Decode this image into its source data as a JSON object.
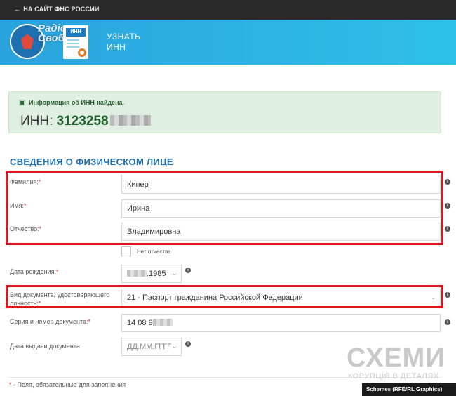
{
  "topbar": {
    "back_label": "НА САЙТ ФНС РОССИИ"
  },
  "banner": {
    "watermark": "Радіо\nСвобода",
    "doc_tag": "ИНН",
    "title": "УЗНАТЬ\nИНН"
  },
  "alert": {
    "message": "Информация об ИНН найдена.",
    "inn_label": "ИНН: ",
    "inn_value": "3123258"
  },
  "section_title": "СВЕДЕНИЯ О ФИЗИЧЕСКОМ ЛИЦЕ",
  "form": {
    "surname": {
      "label": "Фамилия:",
      "value": "Кипер"
    },
    "name": {
      "label": "Имя:",
      "value": "Ирина"
    },
    "patronymic": {
      "label": "Отчество:",
      "value": "Владимировна"
    },
    "no_patronymic_label": "Нет отчества",
    "birth_date": {
      "label": "Дата рождения:",
      "value_suffix": ".1985"
    },
    "doc_type": {
      "label": "Вид документа, удостоверяющего личность:",
      "value": "21 - Паспорт гражданина Российской Федерации"
    },
    "doc_number": {
      "label": "Серия и номер документа:",
      "value": "14 08 9"
    },
    "issue_date": {
      "label": "Дата выдачи документа:",
      "placeholder": "ДД.ММ.ГГГГ"
    },
    "required_mark": "*"
  },
  "footer_note": "- Поля, обязательные для заполнения",
  "logo": {
    "title": "СХЕМИ",
    "subtitle": "КОРУПЦІЯ В ДЕТАЛЯХ"
  },
  "credit": "Schemes (RFE/RL Graphics)",
  "colors": {
    "accent": "#1e6fb0",
    "banner": "#2aa3dc",
    "highlight": "#e3131f",
    "success_bg": "#dff0e2"
  }
}
